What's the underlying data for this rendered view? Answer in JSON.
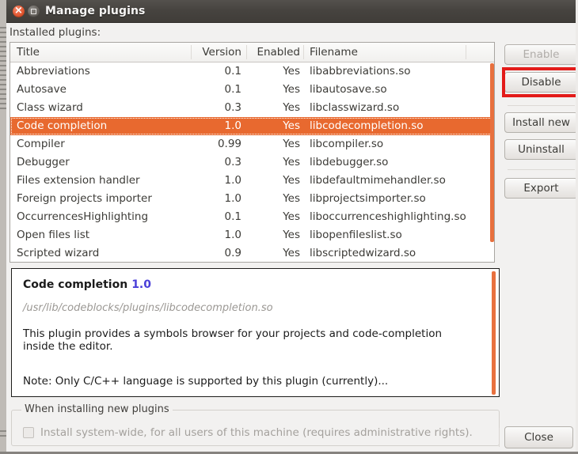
{
  "window": {
    "title": "Manage plugins",
    "close_icon": "window-close-icon",
    "maximize_icon": "window-maximize-icon"
  },
  "main": {
    "section_label": "Installed plugins:",
    "columns": [
      "Title",
      "Version",
      "Enabled",
      "Filename"
    ],
    "rows": [
      {
        "title": "Abbreviations",
        "version": "0.1",
        "enabled": "Yes",
        "filename": "libabbreviations.so",
        "selected": false
      },
      {
        "title": "Autosave",
        "version": "0.1",
        "enabled": "Yes",
        "filename": "libautosave.so",
        "selected": false
      },
      {
        "title": "Class wizard",
        "version": "0.3",
        "enabled": "Yes",
        "filename": "libclasswizard.so",
        "selected": false
      },
      {
        "title": "Code completion",
        "version": "1.0",
        "enabled": "Yes",
        "filename": "libcodecompletion.so",
        "selected": true
      },
      {
        "title": "Compiler",
        "version": "0.99",
        "enabled": "Yes",
        "filename": "libcompiler.so",
        "selected": false
      },
      {
        "title": "Debugger",
        "version": "0.3",
        "enabled": "Yes",
        "filename": "libdebugger.so",
        "selected": false
      },
      {
        "title": "Files extension handler",
        "version": "1.0",
        "enabled": "Yes",
        "filename": "libdefaultmimehandler.so",
        "selected": false
      },
      {
        "title": "Foreign projects importer",
        "version": "1.0",
        "enabled": "Yes",
        "filename": "libprojectsimporter.so",
        "selected": false
      },
      {
        "title": "OccurrencesHighlighting",
        "version": "0.1",
        "enabled": "Yes",
        "filename": "liboccurrenceshighlighting.so",
        "selected": false
      },
      {
        "title": "Open files list",
        "version": "1.0",
        "enabled": "Yes",
        "filename": "libopenfileslist.so",
        "selected": false
      },
      {
        "title": "Scripted wizard",
        "version": "0.9",
        "enabled": "Yes",
        "filename": "libscriptedwizard.so",
        "selected": false
      }
    ]
  },
  "description": {
    "name": "Code completion",
    "version": "1.0",
    "path": "/usr/lib/codeblocks/plugins/libcodecompletion.so",
    "body": "This plugin provides a symbols browser for your projects and code-completion inside the editor.",
    "note": "Note: Only C/C++ language is supported by this plugin (currently)..."
  },
  "install_group": {
    "legend": "When installing new plugins",
    "checkbox_label": "Install system-wide, for all users of this machine (requires administrative rights).",
    "checkbox_checked": false,
    "checkbox_disabled": true
  },
  "actions": {
    "enable": "Enable",
    "enable_disabled": true,
    "disable": "Disable",
    "disable_highlighted": true,
    "install_new": "Install new",
    "uninstall": "Uninstall",
    "export": "Export",
    "close": "Close"
  },
  "colors": {
    "selection": "#e8692f",
    "scrollbar": "#e8703e",
    "highlight_box": "#e31b19",
    "titlebar": "#46433f",
    "version_accent": "#4a3fd8"
  }
}
